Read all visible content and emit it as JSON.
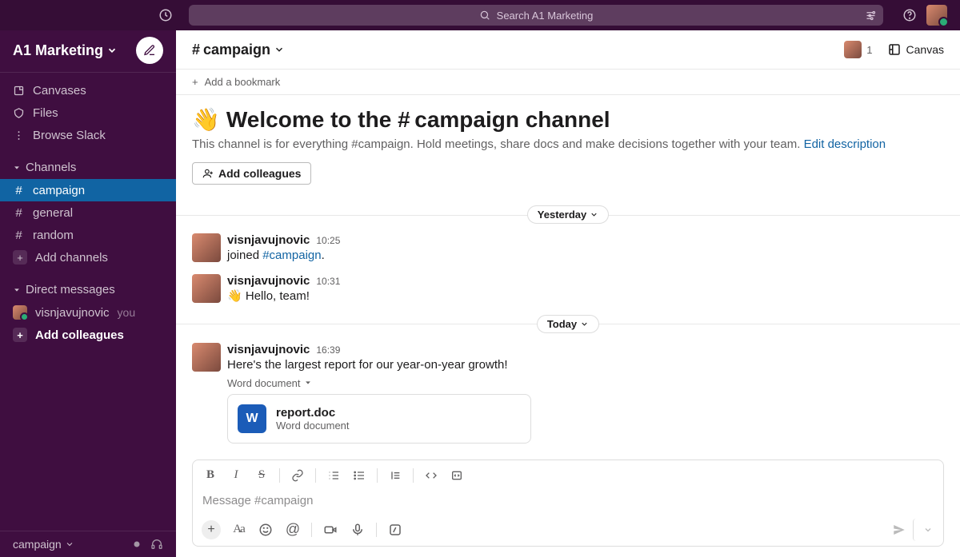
{
  "search": {
    "placeholder": "Search A1 Marketing"
  },
  "workspace": {
    "name": "A1 Marketing"
  },
  "sidebar": {
    "canvases": "Canvases",
    "files": "Files",
    "browse": "Browse Slack",
    "channels_label": "Channels",
    "channels": [
      {
        "name": "campaign",
        "active": true
      },
      {
        "name": "general",
        "active": false
      },
      {
        "name": "random",
        "active": false
      }
    ],
    "add_channels": "Add channels",
    "dms_label": "Direct messages",
    "dm_user": "visnjavujnovic",
    "you": "you",
    "add_colleagues": "Add colleagues"
  },
  "footer": {
    "channel": "campaign"
  },
  "header": {
    "channel": "campaign",
    "member_count": "1",
    "canvas": "Canvas"
  },
  "bookmarks": {
    "add": "Add a bookmark"
  },
  "welcome": {
    "title_prefix": "Welcome to the ",
    "title_channel": "campaign",
    "title_suffix": " channel",
    "desc": "This channel is for everything #campaign. Hold meetings, share docs and make decisions together with your team. ",
    "edit": "Edit description",
    "add_btn": "Add colleagues"
  },
  "dividers": {
    "yesterday": "Yesterday",
    "today": "Today"
  },
  "messages": [
    {
      "user": "visnjavujnovic",
      "time": "10:25",
      "joined_prefix": "joined ",
      "joined_chan": "#campaign",
      "joined_suffix": "."
    },
    {
      "user": "visnjavujnovic",
      "time": "10:31",
      "text": "Hello, team!"
    },
    {
      "user": "visnjavujnovic",
      "time": "16:39",
      "text": "Here's the largest report for our year-on-year growth!",
      "attachment": {
        "label": "Word document",
        "filename": "report.doc",
        "filetype": "Word document",
        "badge": "W"
      }
    }
  ],
  "composer": {
    "placeholder": "Message #campaign"
  }
}
